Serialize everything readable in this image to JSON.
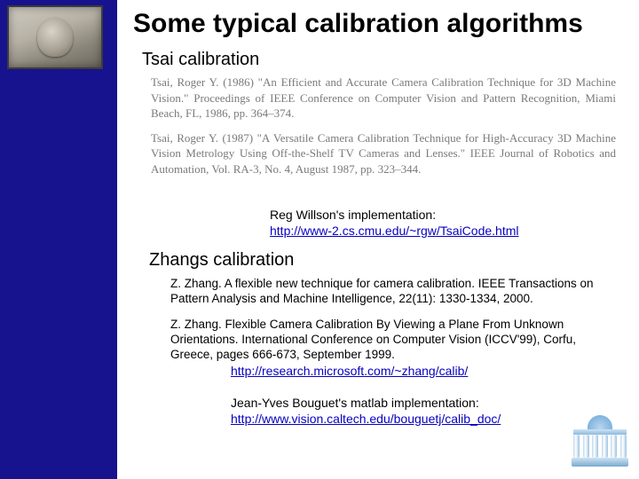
{
  "title": "Some typical calibration algorithms",
  "tsai": {
    "heading": "Tsai calibration",
    "cite1": "Tsai, Roger Y. (1986) \"An Efficient and Accurate Camera Calibration Technique for 3D Machine Vision.\" Proceedings of IEEE Conference on Computer Vision and Pattern Recognition, Miami Beach, FL, 1986, pp. 364–374.",
    "cite2": "Tsai, Roger Y. (1987) \"A Versatile Camera Calibration Technique for High-Accuracy 3D Machine Vision Metrology Using Off-the-Shelf TV Cameras and Lenses.\" IEEE Journal of Robotics and Automation, Vol. RA-3, No. 4, August 1987, pp. 323–344.",
    "impl_label": "Reg Willson's implementation:",
    "impl_link": "http://www-2.cs.cmu.edu/~rgw/TsaiCode.html"
  },
  "zhang": {
    "heading": "Zhangs calibration",
    "cite1": "Z. Zhang. A flexible new technique for camera calibration. IEEE Transactions on Pattern Analysis and Machine Intelligence, 22(11): 1330-1334, 2000.",
    "cite2": "Z. Zhang. Flexible Camera Calibration By Viewing a Plane From Unknown Orientations. International Conference on Computer Vision (ICCV'99), Corfu, Greece, pages 666-673, September 1999.",
    "ms_link": "http://research.microsoft.com/~zhang/calib/",
    "jy_label": "Jean-Yves Bouguet's matlab implementation:",
    "jy_link": "http://www.vision.caltech.edu/bouguetj/calib_doc/"
  }
}
